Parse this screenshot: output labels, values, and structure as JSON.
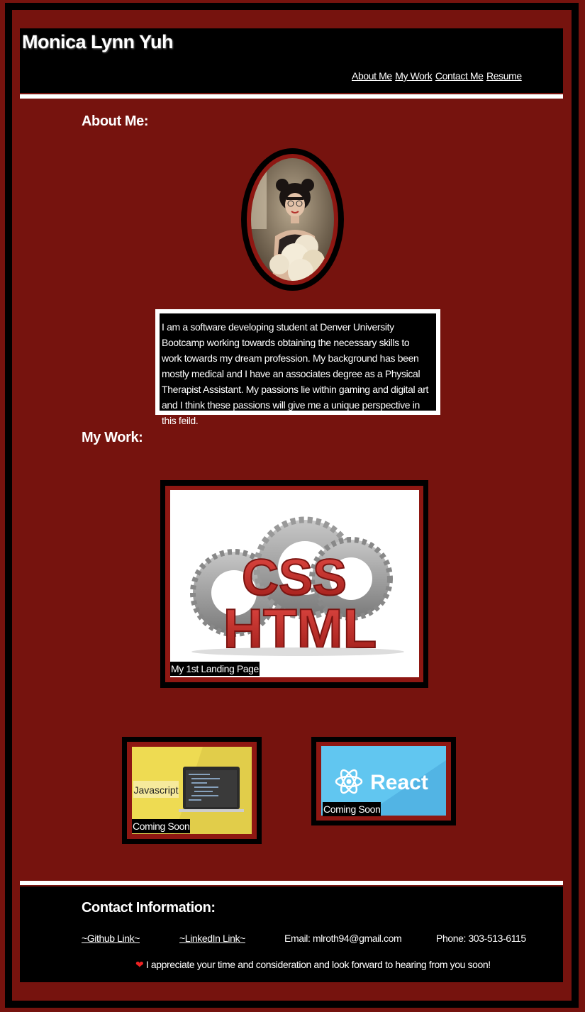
{
  "header": {
    "site_title": "Monica Lynn Yuh",
    "nav": [
      "About Me",
      "My Work",
      "Contact Me",
      "Resume"
    ]
  },
  "about": {
    "heading": "About Me:",
    "bio": "I am a software developing student at Denver University Bootcamp working towards obtaining the necessary skills to work towards my dream profession. My background has been mostly medical and I have an associates degree as a Physical Therapist Assistant. My passions lie within gaming and digital art and I think these passions will give me a unique perspective in this feild."
  },
  "work": {
    "heading": "My Work:",
    "projects": [
      {
        "caption": "My 1st Landing Page",
        "image_text_top": "CSS",
        "image_text_bottom": "HTML"
      },
      {
        "caption": "Coming Soon",
        "image_text": "Javascript"
      },
      {
        "caption": "Coming Soon",
        "image_text": "React"
      }
    ]
  },
  "contact": {
    "heading": "Contact Information:",
    "github": "~Github Link~",
    "linkedin": "~LinkedIn Link~",
    "email": "Email: mlroth94@gmail.com",
    "phone": "Phone: 303-513-6115",
    "message": "I appreciate your time and consideration and look forward to hearing from you soon!"
  },
  "colors": {
    "background": "#76130e",
    "frame": "#000000",
    "accent": "#ffffff"
  }
}
